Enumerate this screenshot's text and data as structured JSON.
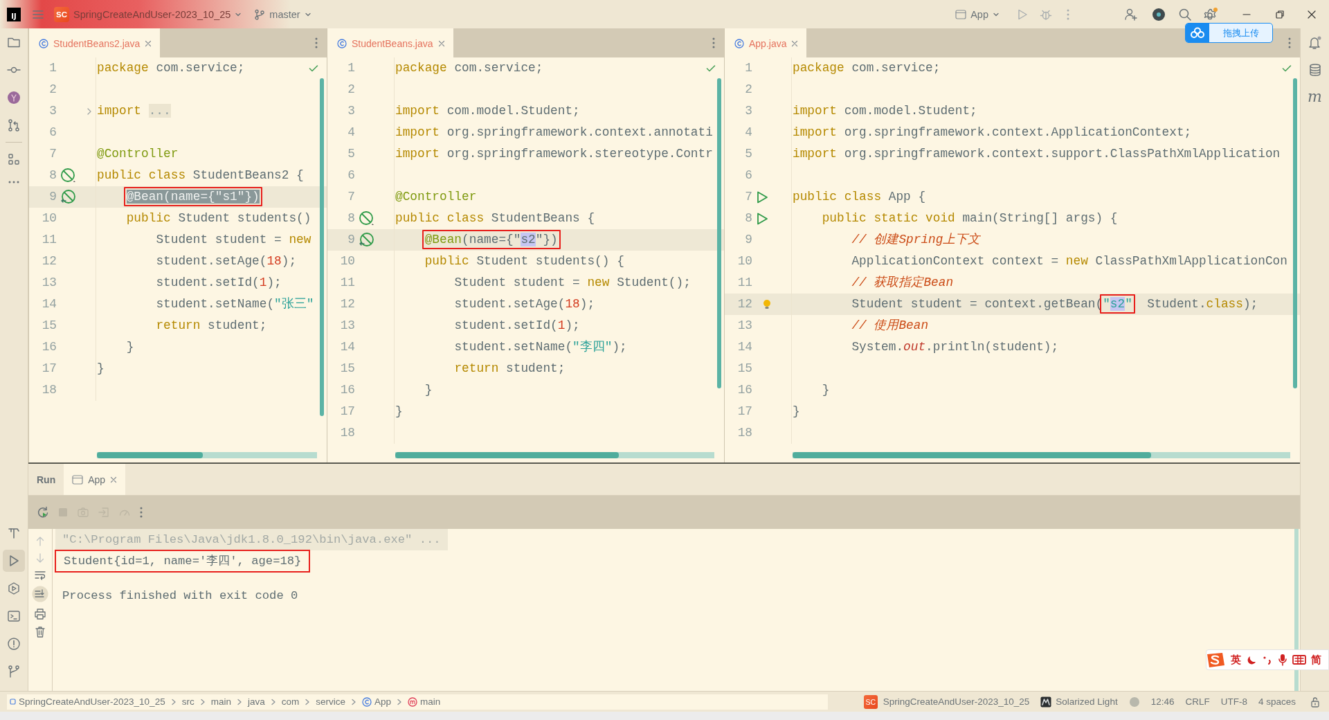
{
  "title_bar": {
    "logo": "IJ",
    "project_badge": "SC",
    "project": "SpringCreateAndUser-2023_10_25",
    "branch": "master",
    "run_config": "App"
  },
  "left_toolbar": {
    "bottom": [
      {
        "selected": false
      },
      {
        "selected": true
      },
      {
        "selected": false
      },
      {
        "selected": false
      },
      {
        "selected": false
      },
      {
        "selected": false
      }
    ]
  },
  "right_toolbar": {
    "letter_button": "m"
  },
  "upload_button": {
    "label": "拖拽上传"
  },
  "editor_panes": [
    {
      "tab": {
        "label": "StudentBeans2.java"
      },
      "lines": [
        {
          "number": "1",
          "current": false,
          "tokens": [
            {
              "kind": "keyword",
              "text": "package"
            },
            {
              "kind": "plain",
              "text": " com.service;"
            }
          ]
        },
        {
          "number": "2",
          "current": false
        },
        {
          "number": "3",
          "current": false,
          "gutter": {
            "kind": "fold"
          },
          "tokens": [
            {
              "kind": "keyword",
              "text": "import "
            },
            {
              "kind": "folded",
              "text": "..."
            }
          ]
        },
        {
          "number": "6",
          "current": false
        },
        {
          "number": "7",
          "current": false,
          "tokens": [
            {
              "kind": "annotation",
              "text": "@Controller"
            }
          ]
        },
        {
          "number": "8",
          "current": false,
          "gutter": {
            "kind": "bean"
          },
          "tokens": [
            {
              "kind": "keyword",
              "text": "public class"
            },
            {
              "kind": "plain",
              "text": " StudentBeans2 {"
            }
          ]
        },
        {
          "number": "9",
          "current": true,
          "gutter": {
            "kind": "bean-method"
          },
          "tokens": [
            {
              "kind": "annotation",
              "text": "    @Bean",
              "selected": true,
              "boxed": true
            },
            {
              "kind": "plain",
              "text": "(name={",
              "selected": true,
              "boxed": true
            },
            {
              "kind": "string",
              "text": "\"s1\"",
              "selected": true,
              "boxed": true
            },
            {
              "kind": "plain",
              "text": "})",
              "selected": true,
              "boxed": true
            }
          ]
        },
        {
          "number": "10",
          "current": false,
          "tokens": [
            {
              "kind": "keyword",
              "text": "    public"
            },
            {
              "kind": "plain",
              "text": " Student students()"
            }
          ]
        },
        {
          "number": "11",
          "current": false,
          "tokens": [
            {
              "kind": "plain",
              "text": "        Student student = "
            },
            {
              "kind": "keyword",
              "text": "new"
            }
          ]
        },
        {
          "number": "12",
          "current": false,
          "tokens": [
            {
              "kind": "plain",
              "text": "        student.setAge("
            },
            {
              "kind": "number",
              "text": "18"
            },
            {
              "kind": "plain",
              "text": ");"
            }
          ]
        },
        {
          "number": "13",
          "current": false,
          "tokens": [
            {
              "kind": "plain",
              "text": "        student.setId("
            },
            {
              "kind": "number",
              "text": "1"
            },
            {
              "kind": "plain",
              "text": ");"
            }
          ]
        },
        {
          "number": "14",
          "current": false,
          "tokens": [
            {
              "kind": "plain",
              "text": "        student.setName("
            },
            {
              "kind": "string",
              "text": "\"张三\""
            }
          ]
        },
        {
          "number": "15",
          "current": false,
          "tokens": [
            {
              "kind": "keyword",
              "text": "        return"
            },
            {
              "kind": "plain",
              "text": " student;"
            }
          ]
        },
        {
          "number": "16",
          "current": false,
          "tokens": [
            {
              "kind": "plain",
              "text": "    }"
            }
          ]
        },
        {
          "number": "17",
          "current": false,
          "tokens": [
            {
              "kind": "plain",
              "text": "}"
            }
          ]
        },
        {
          "number": "18",
          "current": false
        }
      ]
    },
    {
      "tab": {
        "label": "StudentBeans.java"
      },
      "lines": [
        {
          "number": "1",
          "current": false,
          "tokens": [
            {
              "kind": "keyword",
              "text": "package"
            },
            {
              "kind": "plain",
              "text": " com.service;"
            }
          ]
        },
        {
          "number": "2",
          "current": false
        },
        {
          "number": "3",
          "current": false,
          "tokens": [
            {
              "kind": "keyword",
              "text": "import"
            },
            {
              "kind": "plain",
              "text": " com.model.Student;"
            }
          ]
        },
        {
          "number": "4",
          "current": false,
          "tokens": [
            {
              "kind": "keyword",
              "text": "import"
            },
            {
              "kind": "plain",
              "text": " org.springframework.context.annotati"
            }
          ]
        },
        {
          "number": "5",
          "current": false,
          "tokens": [
            {
              "kind": "keyword",
              "text": "import"
            },
            {
              "kind": "plain",
              "text": " org.springframework.stereotype.Contr"
            }
          ]
        },
        {
          "number": "6",
          "current": false
        },
        {
          "number": "7",
          "current": false,
          "tokens": [
            {
              "kind": "annotation",
              "text": "@Controller"
            }
          ]
        },
        {
          "number": "8",
          "current": false,
          "gutter": {
            "kind": "bean"
          },
          "tokens": [
            {
              "kind": "keyword",
              "text": "public class"
            },
            {
              "kind": "plain",
              "text": " StudentBeans {"
            }
          ]
        },
        {
          "number": "9",
          "current": true,
          "gutter": {
            "kind": "bean-method"
          },
          "tokens": [
            {
              "kind": "annotation",
              "text": "    @Bean",
              "boxed": true
            },
            {
              "kind": "plain",
              "text": "(name={\"",
              "boxed": true
            },
            {
              "kind": "plain",
              "text": "s2",
              "highlighted": true,
              "boxed": true
            },
            {
              "kind": "plain",
              "text": "\"})",
              "boxed": true
            }
          ]
        },
        {
          "number": "10",
          "current": false,
          "tokens": [
            {
              "kind": "keyword",
              "text": "    public"
            },
            {
              "kind": "plain",
              "text": " Student students() {"
            }
          ]
        },
        {
          "number": "11",
          "current": false,
          "tokens": [
            {
              "kind": "plain",
              "text": "        Student student = "
            },
            {
              "kind": "keyword",
              "text": "new"
            },
            {
              "kind": "plain",
              "text": " Student();"
            }
          ]
        },
        {
          "number": "12",
          "current": false,
          "tokens": [
            {
              "kind": "plain",
              "text": "        student.setAge("
            },
            {
              "kind": "number",
              "text": "18"
            },
            {
              "kind": "plain",
              "text": ");"
            }
          ]
        },
        {
          "number": "13",
          "current": false,
          "tokens": [
            {
              "kind": "plain",
              "text": "        student.setId("
            },
            {
              "kind": "number",
              "text": "1"
            },
            {
              "kind": "plain",
              "text": ");"
            }
          ]
        },
        {
          "number": "14",
          "current": false,
          "tokens": [
            {
              "kind": "plain",
              "text": "        student.setName("
            },
            {
              "kind": "string",
              "text": "\"李四\""
            },
            {
              "kind": "plain",
              "text": ");"
            }
          ]
        },
        {
          "number": "15",
          "current": false,
          "tokens": [
            {
              "kind": "keyword",
              "text": "        return"
            },
            {
              "kind": "plain",
              "text": " student;"
            }
          ]
        },
        {
          "number": "16",
          "current": false,
          "tokens": [
            {
              "kind": "plain",
              "text": "    }"
            }
          ]
        },
        {
          "number": "17",
          "current": false,
          "tokens": [
            {
              "kind": "plain",
              "text": "}"
            }
          ]
        },
        {
          "number": "18",
          "current": false
        }
      ]
    },
    {
      "tab": {
        "label": "App.java"
      },
      "lines": [
        {
          "number": "1",
          "current": false,
          "tokens": [
            {
              "kind": "keyword",
              "text": "package"
            },
            {
              "kind": "plain",
              "text": " com.service;"
            }
          ]
        },
        {
          "number": "2",
          "current": false
        },
        {
          "number": "3",
          "current": false,
          "tokens": [
            {
              "kind": "keyword",
              "text": "import"
            },
            {
              "kind": "plain",
              "text": " com.model.Student;"
            }
          ]
        },
        {
          "number": "4",
          "current": false,
          "tokens": [
            {
              "kind": "keyword",
              "text": "import"
            },
            {
              "kind": "plain",
              "text": " org.springframework.context.ApplicationContext;"
            }
          ]
        },
        {
          "number": "5",
          "current": false,
          "tokens": [
            {
              "kind": "keyword",
              "text": "import"
            },
            {
              "kind": "plain",
              "text": " org.springframework.context.support.ClassPathXmlApplication"
            }
          ]
        },
        {
          "number": "6",
          "current": false
        },
        {
          "number": "7",
          "current": false,
          "gutter": {
            "kind": "run"
          },
          "tokens": [
            {
              "kind": "keyword",
              "text": "public class"
            },
            {
              "kind": "plain",
              "text": " App {"
            }
          ]
        },
        {
          "number": "8",
          "current": false,
          "gutter": {
            "kind": "run"
          },
          "tokens": [
            {
              "kind": "keyword",
              "text": "    public static void"
            },
            {
              "kind": "plain",
              "text": " main(String[] args) {"
            }
          ]
        },
        {
          "number": "9",
          "current": false,
          "tokens": [
            {
              "kind": "comment",
              "text": "        // 创建Spring上下文"
            }
          ]
        },
        {
          "number": "10",
          "current": false,
          "tokens": [
            {
              "kind": "plain",
              "text": "        ApplicationContext context = "
            },
            {
              "kind": "keyword",
              "text": "new"
            },
            {
              "kind": "plain",
              "text": " ClassPathXmlApplicationCon"
            }
          ]
        },
        {
          "number": "11",
          "current": false,
          "tokens": [
            {
              "kind": "comment",
              "text": "        // 获取指定Bean"
            }
          ]
        },
        {
          "number": "12",
          "current": true,
          "gutter": {
            "kind": "bulb"
          },
          "tokens": [
            {
              "kind": "plain",
              "text": "        Student student = context.getBean("
            },
            {
              "kind": "string",
              "text": "\"",
              "boxed": true
            },
            {
              "kind": "string",
              "text": "s2",
              "highlighted": true,
              "boxed": true
            },
            {
              "kind": "string",
              "text": "\"",
              "boxed": true
            },
            {
              "kind": "plain",
              "text": "  Student."
            },
            {
              "kind": "keyword",
              "text": "class"
            },
            {
              "kind": "plain",
              "text": ");"
            }
          ]
        },
        {
          "number": "13",
          "current": false,
          "tokens": [
            {
              "kind": "comment",
              "text": "        // 使用Bean"
            }
          ]
        },
        {
          "number": "14",
          "current": false,
          "tokens": [
            {
              "kind": "plain",
              "text": "        System."
            },
            {
              "kind": "field",
              "text": "out"
            },
            {
              "kind": "plain",
              "text": ".println(student);"
            }
          ]
        },
        {
          "number": "15",
          "current": false
        },
        {
          "number": "16",
          "current": false,
          "tokens": [
            {
              "kind": "plain",
              "text": "    }"
            }
          ]
        },
        {
          "number": "17",
          "current": false,
          "tokens": [
            {
              "kind": "plain",
              "text": "}"
            }
          ]
        },
        {
          "number": "18",
          "current": false
        }
      ]
    }
  ],
  "run_panel": {
    "title": "Run",
    "tabs": [
      {
        "label": "App",
        "selected": true
      }
    ],
    "console": [
      {
        "kind": "command",
        "text": "\"C:\\Program Files\\Java\\jdk1.8.0_192\\bin\\java.exe\" ...",
        "boxed": false
      },
      {
        "kind": "output",
        "text": "Student{id=1, name='李四', age=18}",
        "boxed": true
      },
      {
        "kind": "exit",
        "text": "Process finished with exit code 0",
        "boxed": false
      }
    ]
  },
  "status_bar": {
    "breadcrumbs": [
      {
        "kind": "module",
        "text": "SpringCreateAndUser-2023_10_25"
      },
      {
        "kind": "folder",
        "text": "src"
      },
      {
        "kind": "folder",
        "text": "main"
      },
      {
        "kind": "folder",
        "text": "java"
      },
      {
        "kind": "folder",
        "text": "com"
      },
      {
        "kind": "folder",
        "text": "service"
      },
      {
        "kind": "class",
        "text": "App"
      },
      {
        "kind": "method",
        "text": "main"
      }
    ],
    "project_badge": "SC",
    "project": "SpringCreateAndUser-2023_10_25",
    "theme": "Solarized Light",
    "position": "12:46",
    "line_separator": "CRLF",
    "encoding": "UTF-8",
    "indent": "4 spaces"
  },
  "input_method": {
    "language": "英",
    "script": "简"
  }
}
